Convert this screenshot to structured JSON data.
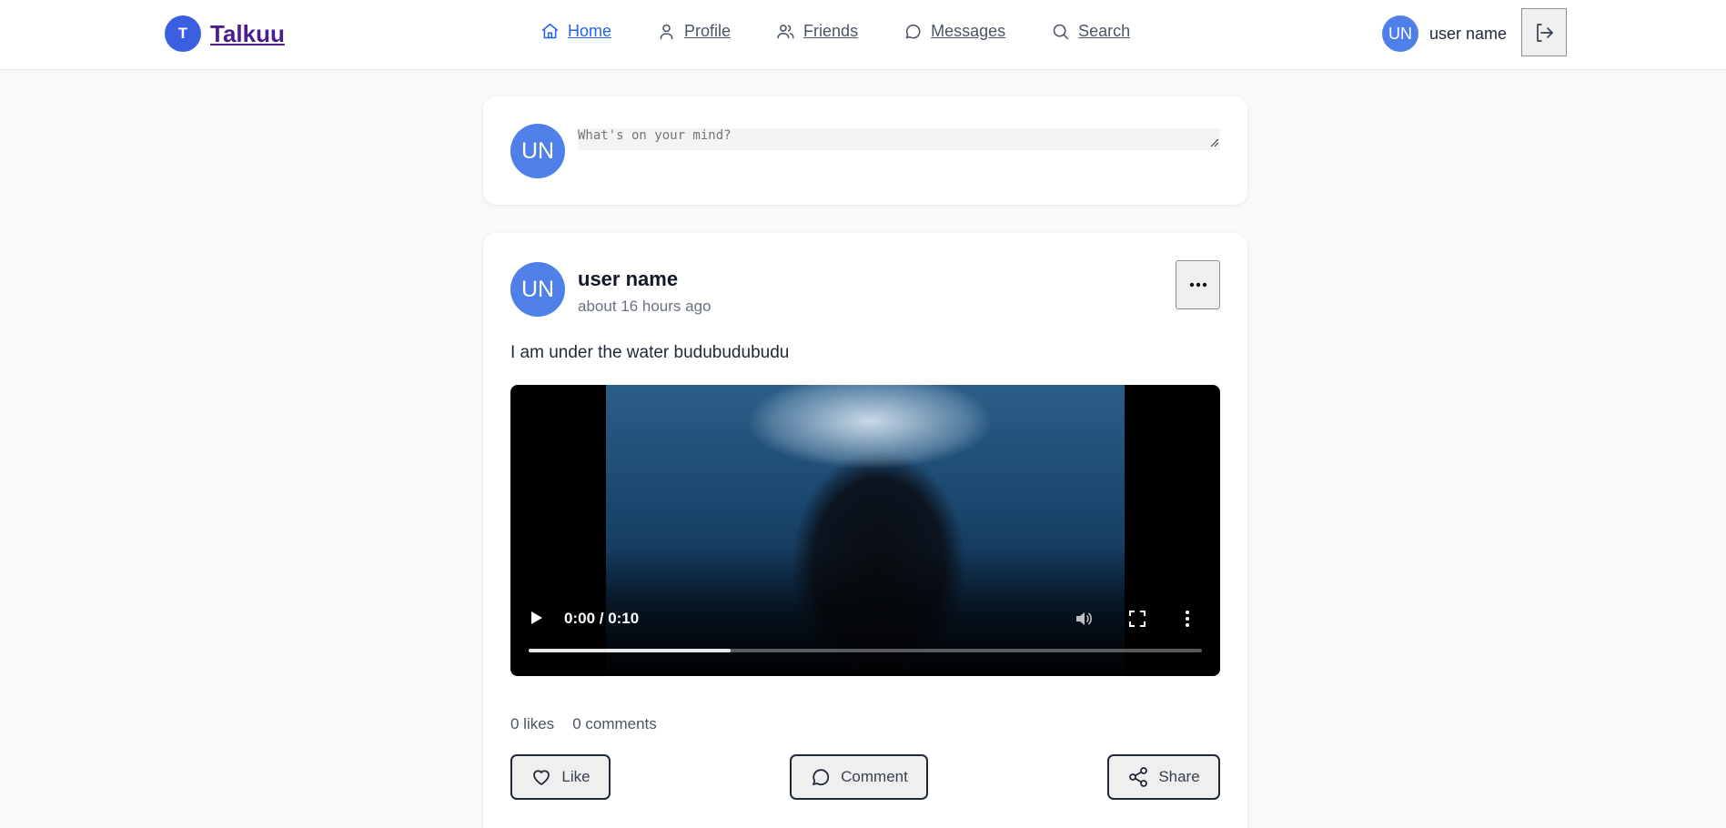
{
  "header": {
    "brand_initial": "T",
    "brand_name": "Talkuu",
    "nav": [
      {
        "label": "Home",
        "icon": "home-icon",
        "active": true
      },
      {
        "label": "Profile",
        "icon": "user-icon",
        "active": false
      },
      {
        "label": "Friends",
        "icon": "users-icon",
        "active": false
      },
      {
        "label": "Messages",
        "icon": "message-circle-icon",
        "active": false
      },
      {
        "label": "Search",
        "icon": "search-icon",
        "active": false
      }
    ],
    "user": {
      "initials": "UN",
      "name": "user name"
    },
    "logout_icon": "logout-icon"
  },
  "composer": {
    "avatar_initials": "UN",
    "placeholder": "What's on your mind?"
  },
  "post": {
    "avatar_initials": "UN",
    "author": "user name",
    "time": "about 16 hours ago",
    "text": "I am under the water budubudubudu",
    "video": {
      "time_display": "0:00 / 0:10",
      "buffered_fraction": 0.3
    },
    "likes": "0 likes",
    "comments": "0 comments",
    "actions": {
      "like": "Like",
      "comment": "Comment",
      "share": "Share"
    }
  },
  "colors": {
    "accent": "#2563eb",
    "brand_badge": "#3b5fe0",
    "brand_text": "#4b1d8f",
    "avatar": "#4f7fe8",
    "background": "#f8f9fb"
  }
}
